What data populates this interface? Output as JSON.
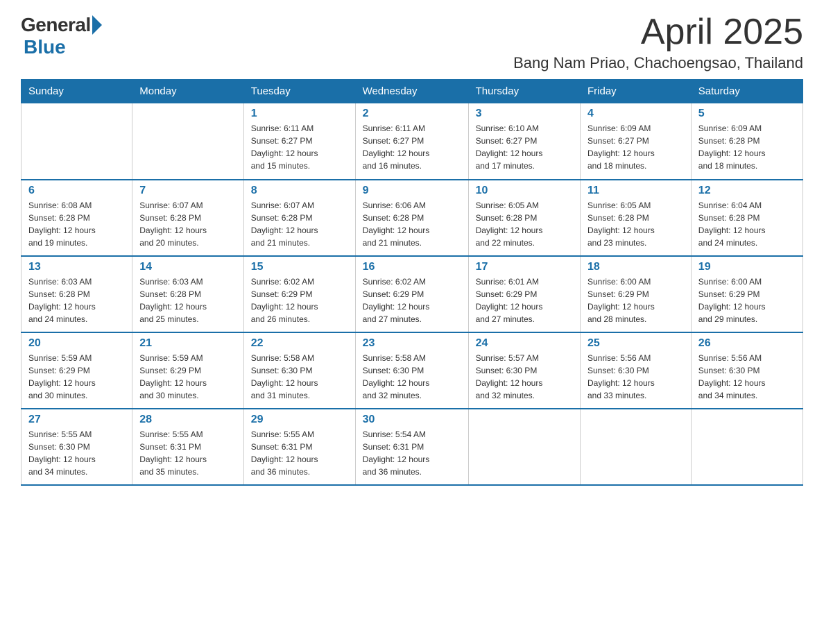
{
  "logo": {
    "general": "General",
    "blue": "Blue"
  },
  "title": {
    "month": "April 2025",
    "location": "Bang Nam Priao, Chachoengsao, Thailand"
  },
  "weekdays": [
    "Sunday",
    "Monday",
    "Tuesday",
    "Wednesday",
    "Thursday",
    "Friday",
    "Saturday"
  ],
  "weeks": [
    [
      {
        "day": "",
        "info": ""
      },
      {
        "day": "",
        "info": ""
      },
      {
        "day": "1",
        "info": "Sunrise: 6:11 AM\nSunset: 6:27 PM\nDaylight: 12 hours\nand 15 minutes."
      },
      {
        "day": "2",
        "info": "Sunrise: 6:11 AM\nSunset: 6:27 PM\nDaylight: 12 hours\nand 16 minutes."
      },
      {
        "day": "3",
        "info": "Sunrise: 6:10 AM\nSunset: 6:27 PM\nDaylight: 12 hours\nand 17 minutes."
      },
      {
        "day": "4",
        "info": "Sunrise: 6:09 AM\nSunset: 6:27 PM\nDaylight: 12 hours\nand 18 minutes."
      },
      {
        "day": "5",
        "info": "Sunrise: 6:09 AM\nSunset: 6:28 PM\nDaylight: 12 hours\nand 18 minutes."
      }
    ],
    [
      {
        "day": "6",
        "info": "Sunrise: 6:08 AM\nSunset: 6:28 PM\nDaylight: 12 hours\nand 19 minutes."
      },
      {
        "day": "7",
        "info": "Sunrise: 6:07 AM\nSunset: 6:28 PM\nDaylight: 12 hours\nand 20 minutes."
      },
      {
        "day": "8",
        "info": "Sunrise: 6:07 AM\nSunset: 6:28 PM\nDaylight: 12 hours\nand 21 minutes."
      },
      {
        "day": "9",
        "info": "Sunrise: 6:06 AM\nSunset: 6:28 PM\nDaylight: 12 hours\nand 21 minutes."
      },
      {
        "day": "10",
        "info": "Sunrise: 6:05 AM\nSunset: 6:28 PM\nDaylight: 12 hours\nand 22 minutes."
      },
      {
        "day": "11",
        "info": "Sunrise: 6:05 AM\nSunset: 6:28 PM\nDaylight: 12 hours\nand 23 minutes."
      },
      {
        "day": "12",
        "info": "Sunrise: 6:04 AM\nSunset: 6:28 PM\nDaylight: 12 hours\nand 24 minutes."
      }
    ],
    [
      {
        "day": "13",
        "info": "Sunrise: 6:03 AM\nSunset: 6:28 PM\nDaylight: 12 hours\nand 24 minutes."
      },
      {
        "day": "14",
        "info": "Sunrise: 6:03 AM\nSunset: 6:28 PM\nDaylight: 12 hours\nand 25 minutes."
      },
      {
        "day": "15",
        "info": "Sunrise: 6:02 AM\nSunset: 6:29 PM\nDaylight: 12 hours\nand 26 minutes."
      },
      {
        "day": "16",
        "info": "Sunrise: 6:02 AM\nSunset: 6:29 PM\nDaylight: 12 hours\nand 27 minutes."
      },
      {
        "day": "17",
        "info": "Sunrise: 6:01 AM\nSunset: 6:29 PM\nDaylight: 12 hours\nand 27 minutes."
      },
      {
        "day": "18",
        "info": "Sunrise: 6:00 AM\nSunset: 6:29 PM\nDaylight: 12 hours\nand 28 minutes."
      },
      {
        "day": "19",
        "info": "Sunrise: 6:00 AM\nSunset: 6:29 PM\nDaylight: 12 hours\nand 29 minutes."
      }
    ],
    [
      {
        "day": "20",
        "info": "Sunrise: 5:59 AM\nSunset: 6:29 PM\nDaylight: 12 hours\nand 30 minutes."
      },
      {
        "day": "21",
        "info": "Sunrise: 5:59 AM\nSunset: 6:29 PM\nDaylight: 12 hours\nand 30 minutes."
      },
      {
        "day": "22",
        "info": "Sunrise: 5:58 AM\nSunset: 6:30 PM\nDaylight: 12 hours\nand 31 minutes."
      },
      {
        "day": "23",
        "info": "Sunrise: 5:58 AM\nSunset: 6:30 PM\nDaylight: 12 hours\nand 32 minutes."
      },
      {
        "day": "24",
        "info": "Sunrise: 5:57 AM\nSunset: 6:30 PM\nDaylight: 12 hours\nand 32 minutes."
      },
      {
        "day": "25",
        "info": "Sunrise: 5:56 AM\nSunset: 6:30 PM\nDaylight: 12 hours\nand 33 minutes."
      },
      {
        "day": "26",
        "info": "Sunrise: 5:56 AM\nSunset: 6:30 PM\nDaylight: 12 hours\nand 34 minutes."
      }
    ],
    [
      {
        "day": "27",
        "info": "Sunrise: 5:55 AM\nSunset: 6:30 PM\nDaylight: 12 hours\nand 34 minutes."
      },
      {
        "day": "28",
        "info": "Sunrise: 5:55 AM\nSunset: 6:31 PM\nDaylight: 12 hours\nand 35 minutes."
      },
      {
        "day": "29",
        "info": "Sunrise: 5:55 AM\nSunset: 6:31 PM\nDaylight: 12 hours\nand 36 minutes."
      },
      {
        "day": "30",
        "info": "Sunrise: 5:54 AM\nSunset: 6:31 PM\nDaylight: 12 hours\nand 36 minutes."
      },
      {
        "day": "",
        "info": ""
      },
      {
        "day": "",
        "info": ""
      },
      {
        "day": "",
        "info": ""
      }
    ]
  ]
}
